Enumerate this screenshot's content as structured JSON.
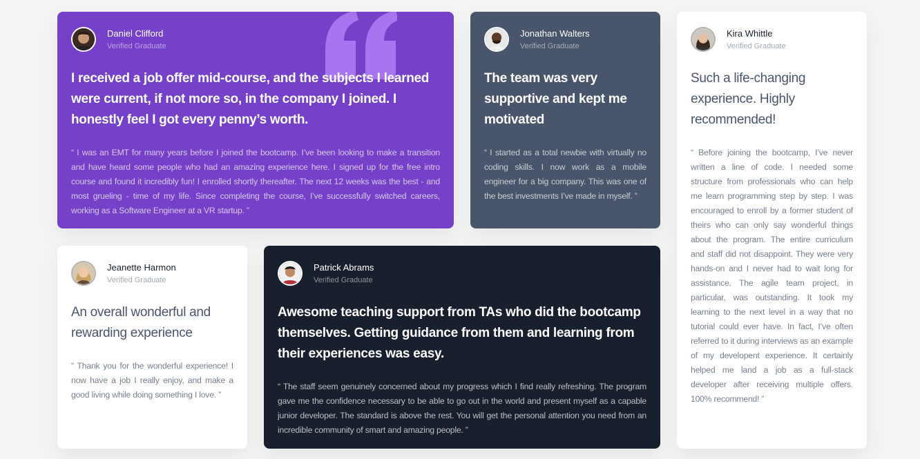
{
  "colors": {
    "purple": "#7541c8",
    "slate": "#48556a",
    "dark": "#19202d",
    "white": "#ffffff",
    "background": "#f4f4f4"
  },
  "testimonials": [
    {
      "name": "Daniel Clifford",
      "role": "Verified Graduate",
      "title": "I received a job offer mid-course, and the subjects I learned were current, if not more so, in the company I joined. I honestly feel I got every penny’s worth.",
      "quote": "“ I was an EMT for many years before I joined the bootcamp. I’ve been looking to make a transition and have heard some people who had an amazing experience here. I signed up for the free intro course and found it incredibly fun! I enrolled shortly thereafter. The next 12 weeks was the best - and most grueling - time of my life. Since completing the course, I’ve successfully switched careers, working as a Software Engineer at a VR startup. ”"
    },
    {
      "name": "Jonathan Walters",
      "role": "Verified Graduate",
      "title": "The team was very supportive and kept me motivated",
      "quote": "“ I started as a total newbie with virtually no coding skills. I now work as a mobile engineer for a big company. This was one of the best investments I’ve made in myself. ”"
    },
    {
      "name": "Jeanette Harmon",
      "role": "Verified Graduate",
      "title": "An overall wonderful and rewarding experience",
      "quote": "“ Thank you for the wonderful experience! I now have a job I really enjoy, and make a good living while doing something I love. ”"
    },
    {
      "name": "Patrick Abrams",
      "role": "Verified Graduate",
      "title": "Awesome teaching support from TAs who did the bootcamp themselves. Getting guidance from them and learning from their experiences was easy.",
      "quote": "“ The staff seem genuinely concerned about my progress which I find really refreshing. The program gave me the confidence necessary to be able to go out in the world and present myself as a capable junior developer. The standard is above the rest. You will get the personal attention you need from an incredible community of smart and amazing people. ”"
    },
    {
      "name": "Kira Whittle",
      "role": "Verified Graduate",
      "title": "Such a life-changing experience. Highly recommended!",
      "quote": "“ Before joining the bootcamp, I’ve never written a line of code. I needed some structure from professionals who can help me learn programming step by step. I was encouraged to enroll by a former student of theirs who can only say wonderful things about the program. The entire curriculum and staff did not disappoint. They were very hands-on and I never had to wait long for assistance. The agile team project, in particular, was outstanding. It took my learning to the next level in a way that no tutorial could ever have. In fact, I’ve often referred to it during interviews as an example of my developent experience. It certainly helped me land a job as a full-stack developer after receiving multiple offers. 100% recommend! ”"
    }
  ]
}
